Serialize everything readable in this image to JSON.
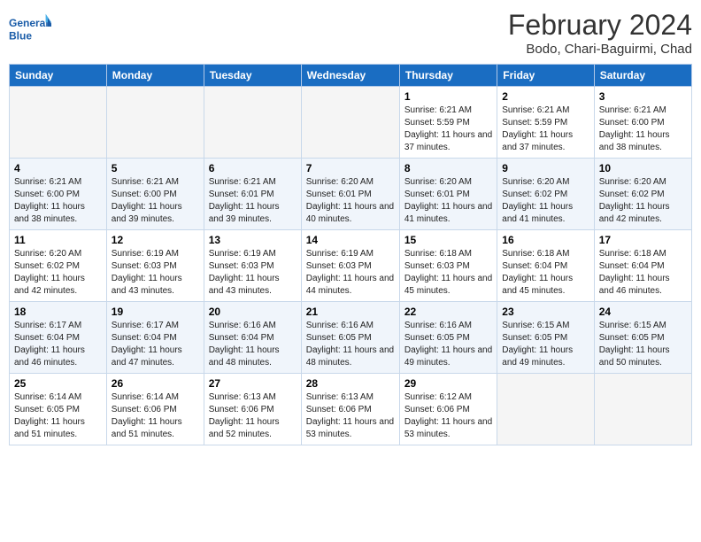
{
  "header": {
    "logo_text_general": "General",
    "logo_text_blue": "Blue",
    "month_year": "February 2024",
    "location": "Bodo, Chari-Baguirmi, Chad"
  },
  "days_of_week": [
    "Sunday",
    "Monday",
    "Tuesday",
    "Wednesday",
    "Thursday",
    "Friday",
    "Saturday"
  ],
  "weeks": [
    [
      {
        "day": "",
        "info": ""
      },
      {
        "day": "",
        "info": ""
      },
      {
        "day": "",
        "info": ""
      },
      {
        "day": "",
        "info": ""
      },
      {
        "day": "1",
        "info": "Sunrise: 6:21 AM\nSunset: 5:59 PM\nDaylight: 11 hours and 37 minutes."
      },
      {
        "day": "2",
        "info": "Sunrise: 6:21 AM\nSunset: 5:59 PM\nDaylight: 11 hours and 37 minutes."
      },
      {
        "day": "3",
        "info": "Sunrise: 6:21 AM\nSunset: 6:00 PM\nDaylight: 11 hours and 38 minutes."
      }
    ],
    [
      {
        "day": "4",
        "info": "Sunrise: 6:21 AM\nSunset: 6:00 PM\nDaylight: 11 hours and 38 minutes."
      },
      {
        "day": "5",
        "info": "Sunrise: 6:21 AM\nSunset: 6:00 PM\nDaylight: 11 hours and 39 minutes."
      },
      {
        "day": "6",
        "info": "Sunrise: 6:21 AM\nSunset: 6:01 PM\nDaylight: 11 hours and 39 minutes."
      },
      {
        "day": "7",
        "info": "Sunrise: 6:20 AM\nSunset: 6:01 PM\nDaylight: 11 hours and 40 minutes."
      },
      {
        "day": "8",
        "info": "Sunrise: 6:20 AM\nSunset: 6:01 PM\nDaylight: 11 hours and 41 minutes."
      },
      {
        "day": "9",
        "info": "Sunrise: 6:20 AM\nSunset: 6:02 PM\nDaylight: 11 hours and 41 minutes."
      },
      {
        "day": "10",
        "info": "Sunrise: 6:20 AM\nSunset: 6:02 PM\nDaylight: 11 hours and 42 minutes."
      }
    ],
    [
      {
        "day": "11",
        "info": "Sunrise: 6:20 AM\nSunset: 6:02 PM\nDaylight: 11 hours and 42 minutes."
      },
      {
        "day": "12",
        "info": "Sunrise: 6:19 AM\nSunset: 6:03 PM\nDaylight: 11 hours and 43 minutes."
      },
      {
        "day": "13",
        "info": "Sunrise: 6:19 AM\nSunset: 6:03 PM\nDaylight: 11 hours and 43 minutes."
      },
      {
        "day": "14",
        "info": "Sunrise: 6:19 AM\nSunset: 6:03 PM\nDaylight: 11 hours and 44 minutes."
      },
      {
        "day": "15",
        "info": "Sunrise: 6:18 AM\nSunset: 6:03 PM\nDaylight: 11 hours and 45 minutes."
      },
      {
        "day": "16",
        "info": "Sunrise: 6:18 AM\nSunset: 6:04 PM\nDaylight: 11 hours and 45 minutes."
      },
      {
        "day": "17",
        "info": "Sunrise: 6:18 AM\nSunset: 6:04 PM\nDaylight: 11 hours and 46 minutes."
      }
    ],
    [
      {
        "day": "18",
        "info": "Sunrise: 6:17 AM\nSunset: 6:04 PM\nDaylight: 11 hours and 46 minutes."
      },
      {
        "day": "19",
        "info": "Sunrise: 6:17 AM\nSunset: 6:04 PM\nDaylight: 11 hours and 47 minutes."
      },
      {
        "day": "20",
        "info": "Sunrise: 6:16 AM\nSunset: 6:04 PM\nDaylight: 11 hours and 48 minutes."
      },
      {
        "day": "21",
        "info": "Sunrise: 6:16 AM\nSunset: 6:05 PM\nDaylight: 11 hours and 48 minutes."
      },
      {
        "day": "22",
        "info": "Sunrise: 6:16 AM\nSunset: 6:05 PM\nDaylight: 11 hours and 49 minutes."
      },
      {
        "day": "23",
        "info": "Sunrise: 6:15 AM\nSunset: 6:05 PM\nDaylight: 11 hours and 49 minutes."
      },
      {
        "day": "24",
        "info": "Sunrise: 6:15 AM\nSunset: 6:05 PM\nDaylight: 11 hours and 50 minutes."
      }
    ],
    [
      {
        "day": "25",
        "info": "Sunrise: 6:14 AM\nSunset: 6:05 PM\nDaylight: 11 hours and 51 minutes."
      },
      {
        "day": "26",
        "info": "Sunrise: 6:14 AM\nSunset: 6:06 PM\nDaylight: 11 hours and 51 minutes."
      },
      {
        "day": "27",
        "info": "Sunrise: 6:13 AM\nSunset: 6:06 PM\nDaylight: 11 hours and 52 minutes."
      },
      {
        "day": "28",
        "info": "Sunrise: 6:13 AM\nSunset: 6:06 PM\nDaylight: 11 hours and 53 minutes."
      },
      {
        "day": "29",
        "info": "Sunrise: 6:12 AM\nSunset: 6:06 PM\nDaylight: 11 hours and 53 minutes."
      },
      {
        "day": "",
        "info": ""
      },
      {
        "day": "",
        "info": ""
      }
    ]
  ]
}
